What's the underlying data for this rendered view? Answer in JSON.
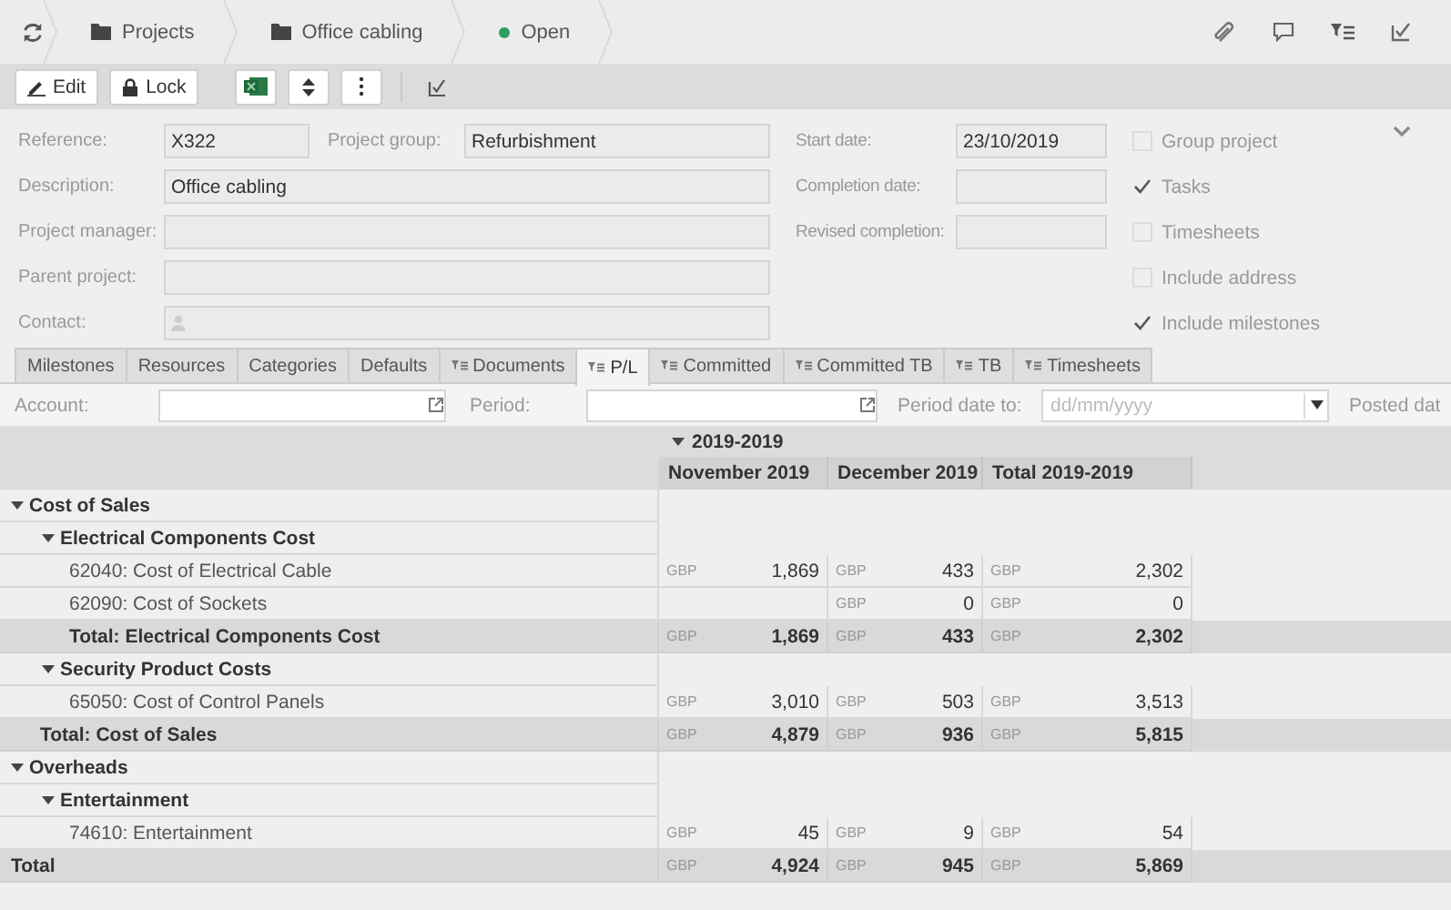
{
  "breadcrumb": [
    {
      "kind": "folder",
      "label": "Projects"
    },
    {
      "kind": "folder",
      "label": "Office cabling"
    },
    {
      "kind": "status",
      "label": "Open",
      "color": "#2e9e5e"
    }
  ],
  "toolbar": [
    {
      "kind": "edit",
      "label": "Edit"
    },
    {
      "kind": "lock",
      "label": "Lock"
    },
    {
      "kind": "excel"
    },
    {
      "kind": "sort"
    },
    {
      "kind": "more"
    },
    {
      "kind": "separator"
    },
    {
      "kind": "check"
    }
  ],
  "form": {
    "main_rows": [
      [
        {
          "kind": "text",
          "label": "Reference:",
          "value": "X322"
        },
        {
          "kind": "text",
          "label": "Project group:",
          "value": "Refurbishment"
        }
      ],
      [
        {
          "kind": "text",
          "label": "Description:",
          "value": "Office cabling"
        }
      ],
      [
        {
          "kind": "text",
          "label": "Project manager:"
        }
      ],
      [
        {
          "kind": "text",
          "label": "Parent project:"
        }
      ],
      [
        {
          "kind": "contact",
          "label": "Contact:"
        }
      ]
    ],
    "date_fields": [
      {
        "label": "Start date:",
        "value": "23/10/2019"
      },
      {
        "label": "Completion date:"
      },
      {
        "label": "Revised completion:"
      }
    ],
    "options": [
      {
        "label": "Group project",
        "checked": false
      },
      {
        "label": "Tasks",
        "checked": true
      },
      {
        "label": "Timesheets",
        "checked": false
      },
      {
        "label": "Include address",
        "checked": false
      },
      {
        "label": "Include milestones",
        "checked": true
      }
    ]
  },
  "tabs": [
    {
      "kind": "plain",
      "label": "Milestones",
      "selected": false
    },
    {
      "kind": "plain",
      "label": "Resources",
      "selected": false
    },
    {
      "kind": "plain",
      "label": "Categories",
      "selected": false
    },
    {
      "kind": "plain",
      "label": "Defaults",
      "selected": false
    },
    {
      "kind": "pivot",
      "label": "Documents",
      "selected": false
    },
    {
      "kind": "pivot",
      "label": "P/L",
      "selected": true
    },
    {
      "kind": "pivot",
      "label": "Committed",
      "selected": false
    },
    {
      "kind": "pivot",
      "label": "Committed TB",
      "selected": false
    },
    {
      "kind": "pivot",
      "label": "TB",
      "selected": false
    },
    {
      "kind": "pivot",
      "label": "Timesheets",
      "selected": false
    }
  ],
  "filters": [
    {
      "kind": "lookup",
      "label": "Account:"
    },
    {
      "kind": "lookup",
      "label": "Period:"
    },
    {
      "kind": "date",
      "label": "Period date to:",
      "placeholder": "dd/mm/yyyy"
    },
    {
      "kind": "label",
      "label": "Posted dat"
    }
  ],
  "pivot": {
    "column_group": {
      "label": "2019-2019",
      "expanded": true
    },
    "columns": [
      "November 2019",
      "December 2019",
      "Total 2019-2019"
    ],
    "rows": [
      {
        "kind": "group",
        "label": "Cost of Sales",
        "expanded": true,
        "children": [
          {
            "kind": "group",
            "label": "Electrical Components Cost",
            "expanded": true,
            "children": [
              {
                "kind": "account",
                "label": "62040: Cost of Electrical Cable",
                "cells": [
                  {
                    "currency": "GBP",
                    "amount": "1,869"
                  },
                  {
                    "currency": "GBP",
                    "amount": "433"
                  },
                  {
                    "currency": "GBP",
                    "amount": "2,302"
                  }
                ]
              },
              {
                "kind": "account",
                "label": "62090: Cost of Sockets",
                "cells": [
                  null,
                  {
                    "currency": "GBP",
                    "amount": "0"
                  },
                  {
                    "currency": "GBP",
                    "amount": "0"
                  }
                ]
              },
              {
                "kind": "total",
                "label": "Total: Electrical Components Cost",
                "cells": [
                  {
                    "currency": "GBP",
                    "amount": "1,869"
                  },
                  {
                    "currency": "GBP",
                    "amount": "433"
                  },
                  {
                    "currency": "GBP",
                    "amount": "2,302"
                  }
                ]
              }
            ]
          },
          {
            "kind": "group",
            "label": "Security Product Costs",
            "expanded": true,
            "children": [
              {
                "kind": "account",
                "label": "65050: Cost of Control Panels",
                "cells": [
                  {
                    "currency": "GBP",
                    "amount": "3,010"
                  },
                  {
                    "currency": "GBP",
                    "amount": "503"
                  },
                  {
                    "currency": "GBP",
                    "amount": "3,513"
                  }
                ]
              }
            ]
          },
          {
            "kind": "total",
            "label": "Total: Cost of Sales",
            "cells": [
              {
                "currency": "GBP",
                "amount": "4,879"
              },
              {
                "currency": "GBP",
                "amount": "936"
              },
              {
                "currency": "GBP",
                "amount": "5,815"
              }
            ]
          }
        ]
      },
      {
        "kind": "group",
        "label": "Overheads",
        "expanded": true,
        "children": [
          {
            "kind": "group",
            "label": "Entertainment",
            "expanded": true,
            "children": [
              {
                "kind": "account",
                "label": "74610: Entertainment",
                "cells": [
                  {
                    "currency": "GBP",
                    "amount": "45"
                  },
                  {
                    "currency": "GBP",
                    "amount": "9"
                  },
                  {
                    "currency": "GBP",
                    "amount": "54"
                  }
                ]
              }
            ]
          }
        ]
      },
      {
        "kind": "total",
        "label": "Total",
        "cells": [
          {
            "currency": "GBP",
            "amount": "4,924"
          },
          {
            "currency": "GBP",
            "amount": "945"
          },
          {
            "currency": "GBP",
            "amount": "5,869"
          }
        ]
      }
    ]
  }
}
